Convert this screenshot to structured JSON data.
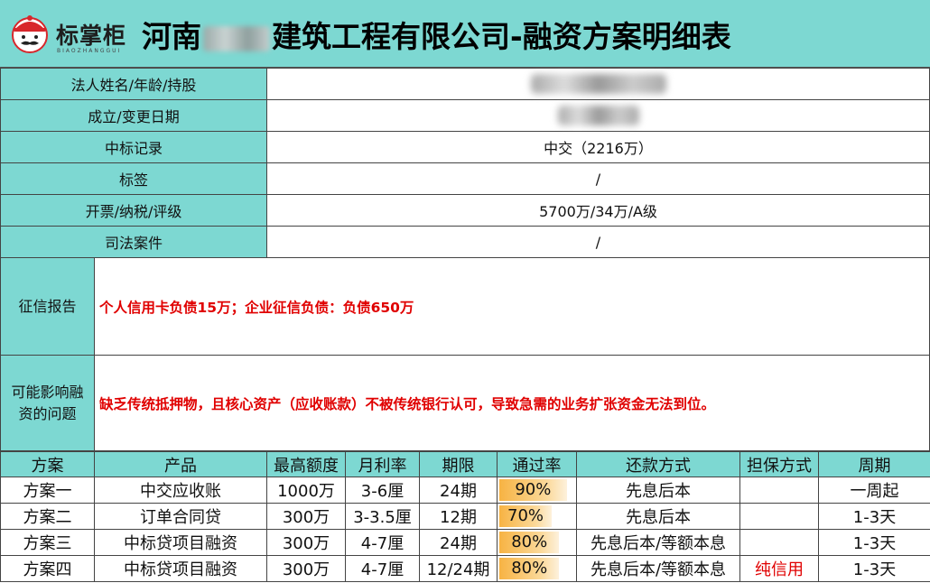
{
  "header": {
    "logo_text": "标掌柜",
    "logo_sub": "BIAOZHANGGUI",
    "title_prefix": "河南",
    "title_suffix": "建筑工程有限公司-融资方案明细表"
  },
  "info_rows": [
    {
      "label": "法人姓名/年龄/持股",
      "value": ""
    },
    {
      "label": "成立/变更日期",
      "value": ""
    },
    {
      "label": "中标记录",
      "value": "中交（2216万）"
    },
    {
      "label": "标签",
      "value": "/"
    },
    {
      "label": "开票/纳税/评级",
      "value": "5700万/34万/A级"
    },
    {
      "label": "司法案件",
      "value": "/"
    }
  ],
  "credit": {
    "label": "征信报告",
    "value": "个人信用卡负债15万；企业征信负债：负债650万"
  },
  "issues": {
    "label": "可能影响融资的问题",
    "value": "缺乏传统抵押物，且核心资产（应收账款）不被传统银行认可，导致急需的业务扩张资金无法到位。"
  },
  "plans": {
    "headers": [
      "方案",
      "产品",
      "最高额度",
      "月利率",
      "期限",
      "通过率",
      "还款方式",
      "担保方式",
      "周期"
    ],
    "rows": [
      {
        "name": "方案一",
        "product": "中交应收账",
        "limit": "1000万",
        "rate": "3-6厘",
        "term": "24期",
        "pass": "90%",
        "pass_value": 0.9,
        "repay": "先息后本",
        "guarantee": "",
        "cycle": "一周起"
      },
      {
        "name": "方案二",
        "product": "订单合同贷",
        "limit": "300万",
        "rate": "3-3.5厘",
        "term": "12期",
        "pass": "70%",
        "pass_value": 0.7,
        "repay": "先息后本",
        "guarantee": "",
        "cycle": "1-3天"
      },
      {
        "name": "方案三",
        "product": "中标贷项目融资",
        "limit": "300万",
        "rate": "4-7厘",
        "term": "24期",
        "pass": "80%",
        "pass_value": 0.8,
        "repay": "先息后本/等额本息",
        "guarantee": "",
        "cycle": "1-3天"
      },
      {
        "name": "方案四",
        "product": "中标贷项目融资",
        "limit": "300万",
        "rate": "4-7厘",
        "term": "12/24期",
        "pass": "80%",
        "pass_value": 0.8,
        "repay": "先息后本/等额本息",
        "guarantee": "纯信用",
        "cycle": "1-3天"
      }
    ]
  }
}
